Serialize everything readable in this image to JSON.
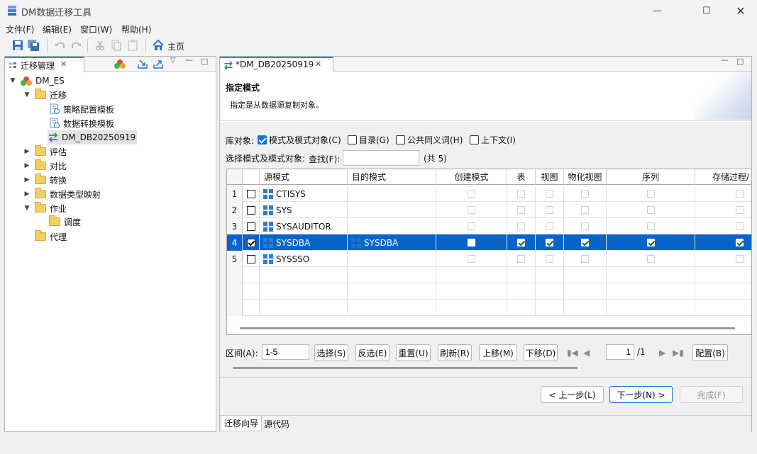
{
  "window": {
    "title": "DM数据迁移工具"
  },
  "menu": [
    "文件(F)",
    "编辑(E)",
    "窗口(W)",
    "帮助(H)"
  ],
  "toolbar": {
    "home_label": "主页"
  },
  "left": {
    "tab_label": "迁移管理",
    "tree": {
      "root": "DM_ES",
      "migrate": "迁移",
      "policy_template": "策略配置模板",
      "convert_template": "数据转换模板",
      "job_item": "DM_DB20250919",
      "evaluate": "评估",
      "compare": "对比",
      "transform": "转换",
      "type_map": "数据类型映射",
      "job": "作业",
      "schedule": "调度",
      "agent": "代理"
    }
  },
  "editor": {
    "tab_label": "*DM_DB20250919",
    "header_title": "指定模式",
    "header_desc": "指定是从数据源复制对象。",
    "lib_label": "库对象:",
    "opt_schema": "模式及模式对象(C)",
    "opt_catalog": "目录(G)",
    "opt_synonym": "公共同义词(H)",
    "opt_context": "上下文(I)",
    "select_label": "选择模式及模式对象:",
    "find_label": "查找(F):",
    "find_value": "",
    "total": "(共 5)",
    "columns": [
      "源模式",
      "目的模式",
      "创建模式",
      "表",
      "视图",
      "物化视图",
      "序列",
      "存储过程/"
    ],
    "rows": [
      {
        "num": "1",
        "src": "CTISYS",
        "dst": "",
        "selected": false,
        "checks": [
          false,
          false,
          false,
          false,
          false,
          false
        ]
      },
      {
        "num": "2",
        "src": "SYS",
        "dst": "",
        "selected": false,
        "checks": [
          false,
          false,
          false,
          false,
          false,
          false
        ]
      },
      {
        "num": "3",
        "src": "SYSAUDITOR",
        "dst": "",
        "selected": false,
        "checks": [
          false,
          false,
          false,
          false,
          false,
          false
        ]
      },
      {
        "num": "4",
        "src": "SYSDBA",
        "dst": "SYSDBA",
        "selected": true,
        "checks": [
          false,
          true,
          true,
          true,
          true,
          true
        ]
      },
      {
        "num": "5",
        "src": "SYSSSO",
        "dst": "",
        "selected": false,
        "checks": [
          false,
          false,
          false,
          false,
          false,
          false
        ]
      }
    ],
    "range_label": "区间(A):",
    "range_value": "1-5",
    "btn_select": "选择(S)",
    "btn_invert": "反选(E)",
    "btn_reset": "重置(U)",
    "btn_refresh": "刷新(R)",
    "btn_up": "上移(M)",
    "btn_down": "下移(D)",
    "page_value": "1",
    "page_total": "/1",
    "btn_config": "配置(B)",
    "btn_prev": "< 上一步(L)",
    "btn_next": "下一步(N) >",
    "btn_finish": "完成(F)",
    "bottom_tab_wizard": "迁移向导",
    "bottom_tab_source": "源代码"
  },
  "colors": {
    "selection": "#0a64c8",
    "accent": "#1b6fd0",
    "folder": "#f3cf62"
  }
}
